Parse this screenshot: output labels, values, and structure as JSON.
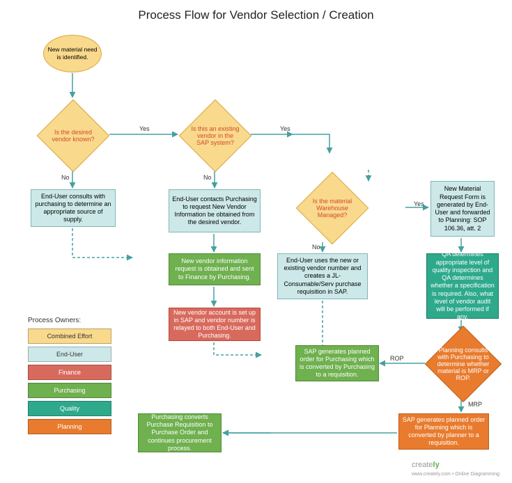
{
  "title": "Process Flow for Vendor Selection / Creation",
  "nodes": {
    "start": "New material need is identified.",
    "d1": "Is the desired vendor known?",
    "d2": "Is this an existing vendor in the SAP system?",
    "d3": "Is the material Warehouse Managed?",
    "consult": "End-User consults with purchasing to determine an appropriate source of supply.",
    "contact": "End-User contacts Purchasing to request New Vendor Information be obtained from the desired vendor.",
    "newreq": "New Material Request Form is generated by End-User and forwarded to Planning: SOP 106.36, att. 2",
    "vendinfo": "New vendor information request is obtained and sent to Finance by Purchasing.",
    "jl": "End-User uses the new or existing vendor number and creates a JL-Consumable/Serv purchase requisition in SAP.",
    "qa": "QA determines appropriate level of quality inspection and QA determines whether a specification is required. Also, what level of vendor audit will be performed if any.",
    "account": "New vendor account is set up in SAP and vendor number is relayed to both End-User and Purchasing.",
    "rop": "SAP generates planned order for Purchasing which is converted by Purchasing to a requisition.",
    "plan": "Planning consults with Purchasing to determine whether material is MRP or ROP.",
    "convert": "Purchasing converts Purchase Requisition to Purchase Order and continues procurement process.",
    "mrp": "SAP generates planned order for Planning which is converted by planner to a requisition."
  },
  "labels": {
    "yes": "Yes",
    "no": "No",
    "rop": "ROP",
    "mrp": "MRP"
  },
  "legend": {
    "title": "Process Owners:",
    "items": [
      "Combined Effort",
      "End-User",
      "Finance",
      "Purchasing",
      "Quality",
      "Planning"
    ]
  },
  "footer": {
    "brand": "creately",
    "tag": "www.creately.com • Online Diagramming"
  }
}
